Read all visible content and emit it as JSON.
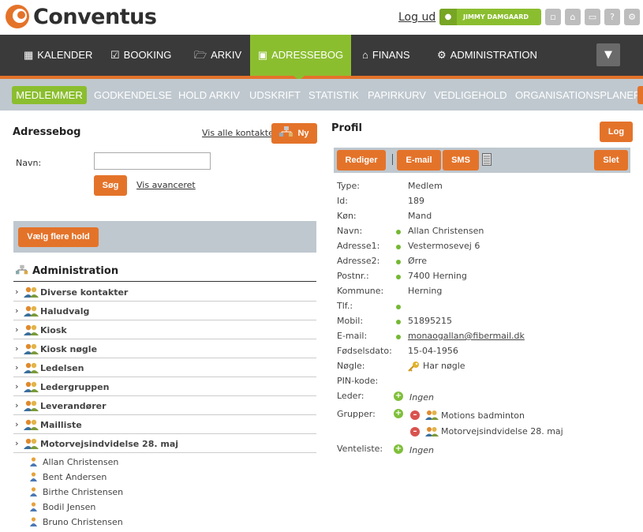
{
  "app": {
    "name": "Conventus"
  },
  "header": {
    "logout": "Log ud",
    "user": "JIMMY DAMGAARD"
  },
  "nav": [
    "KALENDER",
    "BOOKING",
    "ARKIV",
    "ADRESSEBOG",
    "FINANS",
    "ADMINISTRATION"
  ],
  "subnav": [
    "MEDLEMMER",
    "GODKENDELSE",
    "HOLD ARKIV",
    "UDSKRIFT",
    "STATISTIK",
    "PAPIRKURV",
    "VEDLIGEHOLD",
    "ORGANISATIONSPLANER"
  ],
  "left": {
    "title": "Adressebog",
    "vis_alle": "Vis alle kontakter",
    "ny": "Ny",
    "navn_label": "Navn:",
    "navn_value": "",
    "sog": "Søg",
    "vis_avanceret": "Vis avanceret",
    "vaelg": "Vælg flere hold",
    "section": "Administration",
    "groups": [
      "Diverse kontakter",
      "Haludvalg",
      "Kiosk",
      "Kiosk nøgle",
      "Ledelsen",
      "Ledergruppen",
      "Leverandører",
      "Mailliste",
      "Motorvejsindvidelse 28. maj"
    ],
    "members": [
      "Allan Christensen",
      "Bent Andersen",
      "Birthe Christensen",
      "Bodil Jensen",
      "Bruno Christensen"
    ]
  },
  "profile": {
    "title": "Profil",
    "log": "Log",
    "actions": {
      "rediger": "Rediger",
      "email": "E-mail",
      "sms": "SMS",
      "slet": "Slet"
    },
    "labels": {
      "type": "Type:",
      "id": "Id:",
      "kon": "Køn:",
      "navn": "Navn:",
      "adresse1": "Adresse1:",
      "adresse2": "Adresse2:",
      "postnr": "Postnr.:",
      "kommune": "Kommune:",
      "tlf": "Tlf.:",
      "mobil": "Mobil:",
      "email": "E-mail:",
      "fodselsdato": "Fødselsdato:",
      "nogle": "Nøgle:",
      "pin": "PIN-kode:",
      "leder": "Leder:",
      "grupper": "Grupper:",
      "venteliste": "Venteliste:"
    },
    "values": {
      "type": "Medlem",
      "id": "189",
      "kon": "Mand",
      "navn": "Allan Christensen",
      "adresse1": "Vestermosevej 6",
      "adresse2": "Ørre",
      "postnr": "7400 Herning",
      "kommune": "Herning",
      "mobil": "51895215",
      "email": "monaogallan@fibermail.dk",
      "fodselsdato": "15-04-1956",
      "nogle": "Har nøgle",
      "leder": "Ingen",
      "grupper": [
        "Motions badminton",
        "Motorvejsindvidelse 28. maj"
      ],
      "venteliste": "Ingen"
    }
  },
  "colors": {
    "orange": "#e4732a",
    "green": "#8bbe2f",
    "nav_bg": "#3a3a3a",
    "bar_gray": "#bfc8cf"
  }
}
